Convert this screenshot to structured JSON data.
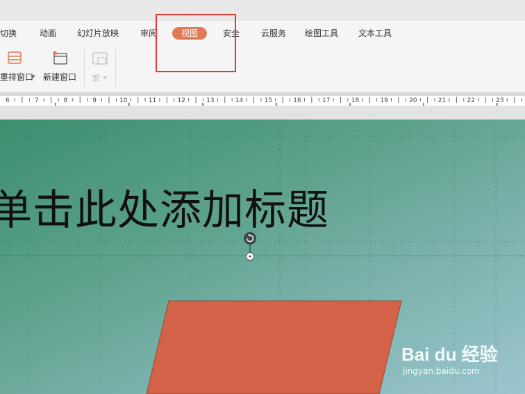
{
  "ribbon": {
    "tabs": [
      {
        "label": "切换"
      },
      {
        "label": "动画"
      },
      {
        "label": "幻灯片放映"
      },
      {
        "label": "审阅"
      },
      {
        "label": "视图",
        "active": true
      },
      {
        "label": "安全"
      },
      {
        "label": "云服务"
      },
      {
        "label": "绘图工具"
      },
      {
        "label": "文本工具"
      }
    ],
    "active_tab_color": "#e07a56",
    "tools": {
      "rearrange_window": "重排窗口",
      "new_window": "新建窗口",
      "macro": "宏"
    }
  },
  "ruler": {
    "numbers": [
      "6",
      "7",
      "8",
      "9",
      "10",
      "11",
      "12",
      "13",
      "14",
      "15",
      "16",
      "17",
      "18",
      "19",
      "20",
      "21",
      "22",
      "23"
    ]
  },
  "slide": {
    "title_placeholder": "单击此处添加标题",
    "shape_color": "#d4634a",
    "watermark_main": "Bai du 经验",
    "watermark_url": "jingyan.baidu.com"
  },
  "annotation": {
    "highlight_color": "#e53935"
  }
}
